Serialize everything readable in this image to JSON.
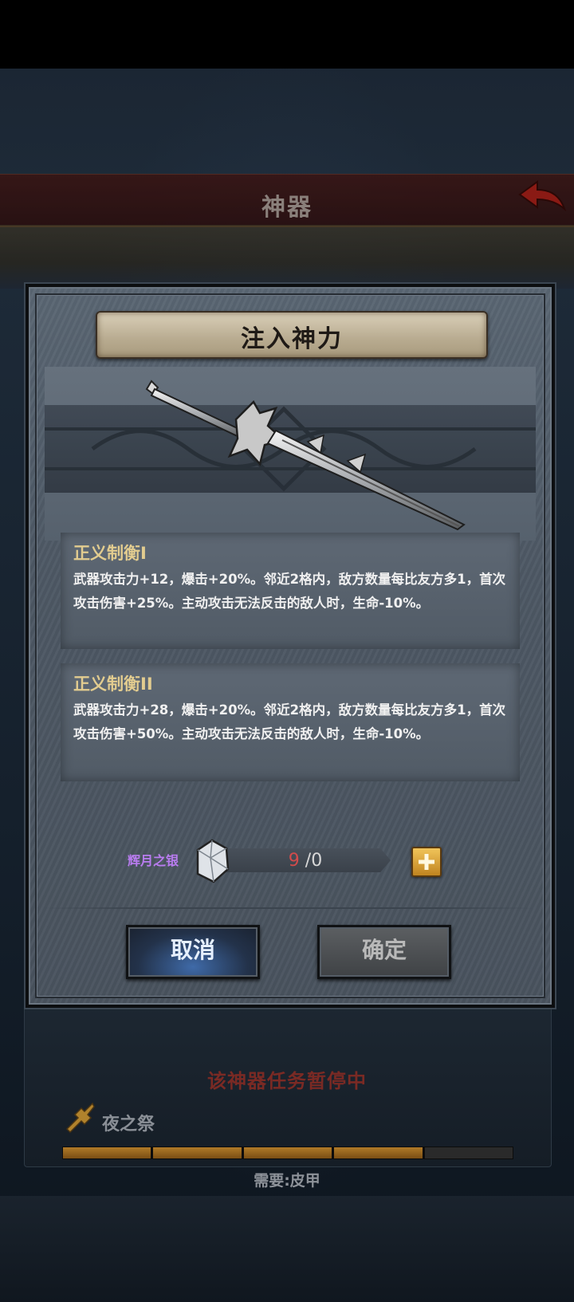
{
  "screen": {
    "header_title": "神器",
    "paused_text": "该神器任务暂停中",
    "artifact_name": "夜之祭",
    "requirement": "需要:皮甲",
    "progress_segments": 5,
    "progress_filled": 4
  },
  "modal": {
    "title": "注入神力",
    "skill_current": {
      "name": "正义制衡I",
      "description": "武器攻击力+12，爆击+20%。邻近2格内，敌方数量每比友方多1，首次攻击伤害+25%。主动攻击无法反击的敌人时，生命-10%。"
    },
    "skill_next": {
      "name": "正义制衡II",
      "description": "武器攻击力+28，爆击+20%。邻近2格内，敌方数量每比友方多1，首次攻击伤害+50%。主动攻击无法反击的敌人时，生命-10%。"
    },
    "material": {
      "name": "辉月之银",
      "have": "9",
      "separator": "/",
      "need": "0",
      "icon": "silver-ore-icon"
    },
    "cancel_label": "取消",
    "confirm_label": "确定"
  },
  "colors": {
    "skill_title": "#e2cc8f",
    "material_name": "#b97cf0",
    "have_count": "#d24b4b",
    "arrow": "#e6a83c"
  }
}
